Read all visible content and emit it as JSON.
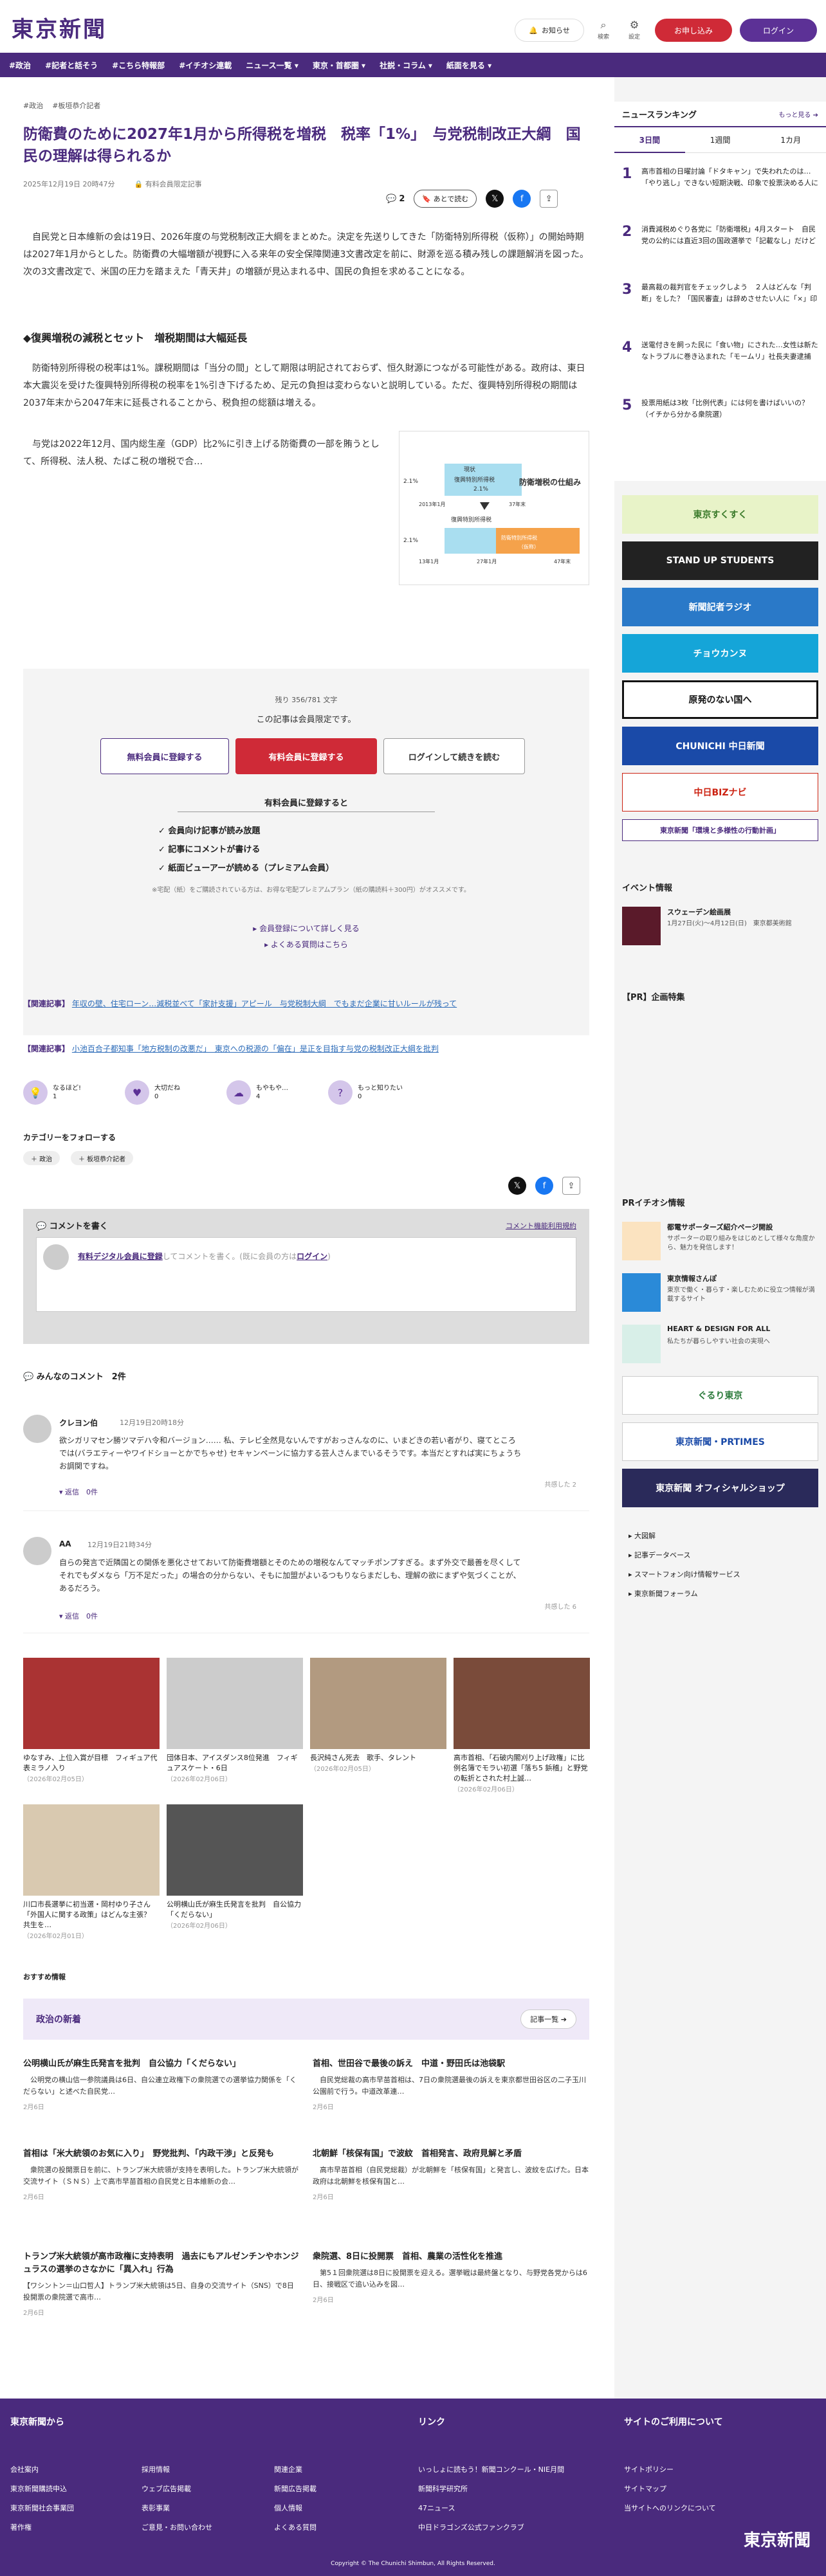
{
  "header": {
    "logo": "東京新聞",
    "notice": "お知らせ",
    "search": "検索",
    "settings": "設定",
    "subscribe": "お申し込み",
    "login": "ログイン"
  },
  "nav": [
    "#政治",
    "#記者と話そう",
    "#こちら特報部",
    "#イチオシ連載",
    "ニュース一覧 ▾",
    "東京・首都圏 ▾",
    "社説・コラム ▾",
    "紙面を見る ▾"
  ],
  "article": {
    "tags": [
      "#政治",
      "#板垣恭介記者"
    ],
    "title": "防衛費のために2027年1月から所得税を増税　税率「1%」　与党税制改正大綱　国民の理解は得られるか",
    "date": "2025年12月19日 20時47分",
    "premium": "有料会員限定記事",
    "comment_count": "2",
    "save": "あとで読む",
    "p1": "　自民党と日本維新の会は19日、2026年度の与党税制改正大綱をまとめた。決定を先送りしてきた「防衛特別所得税（仮称）」の開始時期は2027年1月からとした。防衛費の大幅増額が視野に入る来年の安全保障関連3文書改定を前に、財源を巡る積み残しの課題解消を図った。次の3文書改定で、米国の圧力を踏まえた「青天井」の増額が見込まれる中、国民の負担を求めることになる。",
    "h2": "◆復興増税の減税とセット　増税期間は大幅延長",
    "p2": "　防衛特別所得税の税率は1%。課税期間は「当分の間」として期限は明記されておらず、恒久財源につながる可能性がある。政府は、東日本大震災を受けた復興特別所得税の税率を1%引き下げるため、足元の負担は変わらないと説明している。ただ、復興特別所得税の期間は2037年末から2047年末に延長されることから、税負担の総額は増える。",
    "p3": "　与党は2022年12月、国内総生産（GDP）比2%に引き上げる防衛費の一部を賄うとして、所得税、法人税、たばこ税の増税で合…",
    "figure": {
      "title": "防衛増税の仕組み",
      "label_now": "現状",
      "label_recon": "復興特別所得税",
      "label_recon_rate": "2.1%",
      "label_defense": "防衛特別所得税",
      "label_defense_rate": "（仮称）",
      "y1": "2.1%",
      "y2": "2.1%",
      "x1": "2013年1月",
      "x2": "37年末",
      "x3": "13年1月",
      "x4": "27年1月",
      "x5": "47年末"
    }
  },
  "paywall": {
    "remain": "残り 356/781 文字",
    "notice": "この記事は会員限定です。",
    "btn_free": "無料会員に登録する",
    "btn_paid": "有料会員に登録する",
    "btn_login": "ログインして続きを読む",
    "benefit_title": "有料会員に登録すると",
    "benefits": [
      "✓ 会員向け記事が読み放題",
      "✓ 記事にコメントが書ける",
      "✓ 紙面ビューアーが読める（プレミアム会員）"
    ],
    "note": "※宅配（紙）をご購読されている方は、お得な宅配プレミアムプラン（紙の購読料＋300円）がオススメです。",
    "link1": "▸ 会員登録について詳しく見る",
    "link2": "▸ よくある質問はこちら"
  },
  "related": [
    {
      "label": "【関連記事】",
      "text": "年収の壁、住宅ローン…減税並べて「家計支援」アピール　与党税制大綱　でもまだ企業に甘いルールが残って"
    },
    {
      "label": "【関連記事】",
      "text": "小池百合子都知事「地方税制の改悪だ」　東京への税源の「偏在」是正を目指す与党の税制改正大綱を批判"
    }
  ],
  "reactions": [
    {
      "label": "なるほど!",
      "count": "1"
    },
    {
      "label": "大切だね",
      "count": "0"
    },
    {
      "label": "もやもや…",
      "count": "4"
    },
    {
      "label": "もっと知りたい",
      "count": "0"
    }
  ],
  "categories": {
    "title": "カテゴリーをフォローする",
    "chips": [
      "＋ 政治",
      "＋ 板垣恭介記者"
    ]
  },
  "comment_box": {
    "title": "コメントを書く",
    "rules": "コメント機能利用規約",
    "prompt_link": "有料デジタル会員に登録",
    "prompt_rest": "してコメントを書く。(既に会員の方は",
    "prompt_login": "ログイン",
    "prompt_end": ")"
  },
  "comments": {
    "title": "みんなのコメント　2件",
    "items": [
      {
        "name": "クレヨン伯",
        "time": "12月19日20時18分",
        "body": "欲シガリマセン勝ツマデハ令和バージョン……\n私、テレビ全然見ないんですがおっさんなのに、いまどきの若い者がり、寝てところでは(バラエティーやワイドショーとかでちゃせ) セキャンペーンに協力する芸人さんまでいるそうです。本当だとすれば実にちょうちお調関ですね。",
        "reply": "▾ 返信　0件",
        "agree": "共感した\n2"
      },
      {
        "name": "AA",
        "time": "12月19日21時34分",
        "body": "自らの発言で近隣国との関係を悪化させておいて防衛費増額とそのための増税なんてマッチポンプすぎる。まず外交で最善を尽くしてそれでもダメなら「万不足だった」の場合の分からない、そもに加盟がよいるつもりならまだしも、理解の欲にまずや気づくことが、あるだろう。",
        "reply": "▾ 返信　0件",
        "agree": "共感した\n6"
      }
    ]
  },
  "photos": [
    {
      "cap": "ゆなすみ、上位入賞が目標　フィギュア代表ミラノ入り",
      "date": "（2026年02月05日）"
    },
    {
      "cap": "団体日本、アイスダンス8位発進　フィギュアスケート・6日",
      "date": "（2026年02月06日）"
    },
    {
      "cap": "長沢純さん死去　歌手、タレント",
      "date": "（2026年02月05日）"
    },
    {
      "cap": "高市首相、「石破内閣刈り上げ政権」に比例名簿でモラい初選「落ち5 鋲稽」と野党の転折とされた村上誠…",
      "date": "（2026年02月06日）"
    },
    {
      "cap": "川口市長選挙に初当選・岡村ゆり子さん「外国人に関する政策」はどんな主張？　共生を…",
      "date": "（2026年02月01日）"
    },
    {
      "cap": "公明横山氏が麻生氏発言を批判　自公協力「くだらない」",
      "date": "（2026年02月06日）"
    }
  ],
  "recommended": {
    "title": "おすすめ情報",
    "section": "政治の新着",
    "more": "記事一覧 ➔",
    "news": [
      {
        "title": "公明横山氏が麻生氏発言を批判　自公協力「くだらない」",
        "body": "　公明党の横山信一参院議員は6日、自公連立政権下の衆院選での選挙協力関係を「くだらない」と述べた自民党…",
        "date": "2月6日"
      },
      {
        "title": "首相、世田谷で最後の訴え　中道・野田氏は池袋駅",
        "body": "　自民党総裁の高市早苗首相は、7日の衆院選最後の訴えを東京都世田谷区の二子玉川公園前で行う。中道改革連…",
        "date": "2月6日"
      },
      {
        "title": "首相は「米大統領のお気に入り」　野党批判、「内政干渉」と反発も",
        "body": "　衆院選の投開票日を前に、トランプ米大統領が支持を表明した。トランプ米大統領が交流サイト（ＳＮＳ）上で高市早苗首相の自民党と日本維新の会…",
        "date": "2月6日"
      },
      {
        "title": "北朝鮮「核保有国」で波紋　首相発言、政府見解と矛盾",
        "body": "　高市早苗首相（自民党総裁）が北朝鮮を「核保有国」と発言し、波紋を広げた。日本政府は北朝鮮を核保有国と…",
        "date": "2月6日"
      },
      {
        "title": "トランプ米大統領が高市政権に支持表明　過去にもアルゼンチンやホンジュラスの選挙のさなかに「異入れ」行為",
        "body": "【ワシントン＝山口哲人】トランプ米大統領は5日、自身の交流サイト（SNS）で8日投開票の衆院選で高市…",
        "date": "2月6日"
      },
      {
        "title": "衆院選、8日に投開票　首相、農業の活性化を推進",
        "body": "　第5１回衆院選は8日に投開票を迎える。選挙戦は最終盤となり、与野党各党からは6日、接戦区で追い込みを図…",
        "date": "2月6日"
      }
    ]
  },
  "sidebar": {
    "ranking_title": "ニュースランキング",
    "ranking_more": "もっと見る ➔",
    "tabs": [
      "3日間",
      "1週間",
      "1カ月"
    ],
    "ranking": [
      {
        "num": "1",
        "text": "高市首相の日曜討論「ドタキャン」で失われたのは…「やり逃し」できない短期決戦、印象で投票決める人に"
      },
      {
        "num": "2",
        "text": "消費減税めぐり各党に「防衛増税」4月スタート　自民党の公約には直近3回の国政選挙で「記載なし」だけど"
      },
      {
        "num": "3",
        "text": "最高裁の裁判官をチェックしよう　２人はどんな「判断」をした？「国民審査」は辞めさせたい人に「×」印"
      },
      {
        "num": "4",
        "text": "送電付きを飼った民に「食い物」にされた…女性は新たなトラブルに巻き込まれた「モームリ」社長夫妻逮捕"
      },
      {
        "num": "5",
        "text": "投票用紙は3枚「比例代表」には何を書けばいいの？（イチから分かる衆院選）"
      }
    ],
    "banners": [
      "東京すくすく",
      "STAND UP STUDENTS",
      "新聞記者ラジオ",
      "チョウカンヌ",
      "原発のない国へ",
      "CHUNICHI 中日新聞",
      "中日BIZナビ",
      "東京新聞「環境と多様性の行動計画」"
    ],
    "event_title": "イベント情報",
    "event": {
      "title": "スウェーデン絵画展",
      "body": "1月27日(火)〜4月12日(日)　東京都美術館"
    },
    "pr_title": "【PR】企画特集",
    "pr_pick_title": "PRイチオシ情報",
    "pr_items": [
      {
        "title": "都電サポーターズ紹介ページ開設",
        "body": "サポーターの取り組みをはじめとして様々な角度から、魅力を発信します！"
      },
      {
        "title": "東京情報さんぽ",
        "body": "東京で働く・暮らす・楽しむために役立つ情報が満載するサイト"
      },
      {
        "title": "HEART & DESIGN FOR ALL",
        "body": "私たちが暮らしやすい社会の実現へ"
      }
    ],
    "banners2": [
      "ぐるり東京",
      "東京新聞・PRTIMES",
      "東京新聞 オフィシャルショップ"
    ],
    "links": [
      "▸ 大図解",
      "▸ 記事データベース",
      "▸ スマートフォン向け情報サービス",
      "▸ 東京新聞フォーラム"
    ]
  },
  "footer": {
    "col1_title": "東京新聞から",
    "col1": [
      "会社案内",
      "東京新聞購読申込",
      "東京新聞社会事業団",
      "著作権",
      "採用情報",
      "ウェブ広告掲載",
      "表彰事業",
      "ご意見・お問い合わせ",
      "関連企業",
      "新聞広告掲載",
      "個人情報",
      "よくある質問"
    ],
    "col2_title": "リンク",
    "col2": [
      "いっしょに読もう！新聞コンクール・NIE月間",
      "新聞科学研究所",
      "47ニュース",
      "中日ドラゴンズ公式ファンクラブ"
    ],
    "col3_title": "サイトのご利用について",
    "col3": [
      "サイトポリシー",
      "サイトマップ",
      "当サイトへのリンクについて"
    ],
    "logo": "東京新聞",
    "copyright": "Copyright © The Chunichi Shimbun, All Rights Reserved."
  }
}
